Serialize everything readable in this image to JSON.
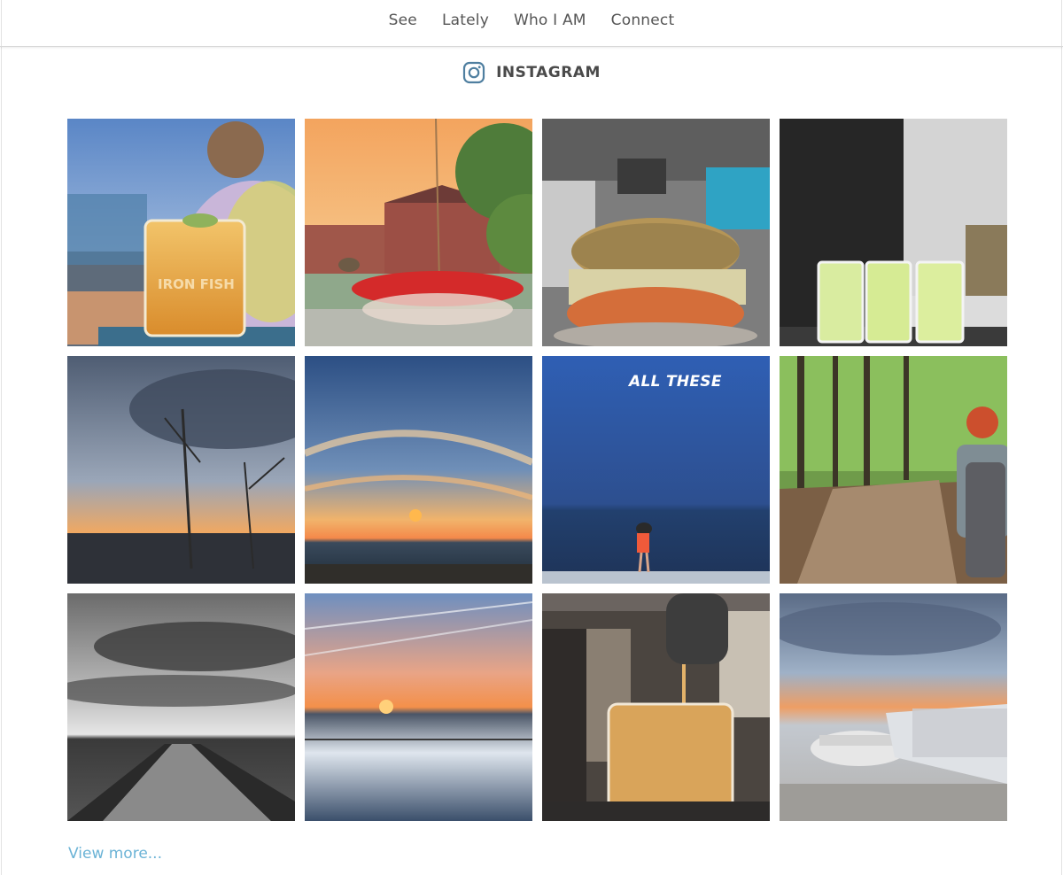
{
  "nav": {
    "items": [
      "See",
      "Lately",
      "Who I AM",
      "Connect"
    ]
  },
  "instagram": {
    "title": "INSTAGRAM",
    "icon": "instagram-icon"
  },
  "grid": {
    "tiles": [
      {
        "name": "tile-iron-fish-cocktail",
        "printed_text": "IRON FISH"
      },
      {
        "name": "tile-hummingbird-feeder"
      },
      {
        "name": "tile-sprout-sandwich"
      },
      {
        "name": "tile-lemonade-shots"
      },
      {
        "name": "tile-winter-sunset"
      },
      {
        "name": "tile-lake-sunset-clouds"
      },
      {
        "name": "tile-beach-dusk",
        "overlay": "ALL THESE"
      },
      {
        "name": "tile-forest-hiker"
      },
      {
        "name": "tile-bw-breakwater"
      },
      {
        "name": "tile-shoreline-sunset"
      },
      {
        "name": "tile-poured-cocktail"
      },
      {
        "name": "tile-airport-jetway"
      }
    ]
  },
  "view_more": "View more...",
  "colors": {
    "link": "#6bb3d6",
    "text": "#555555",
    "divider": "#d9d9d9"
  }
}
